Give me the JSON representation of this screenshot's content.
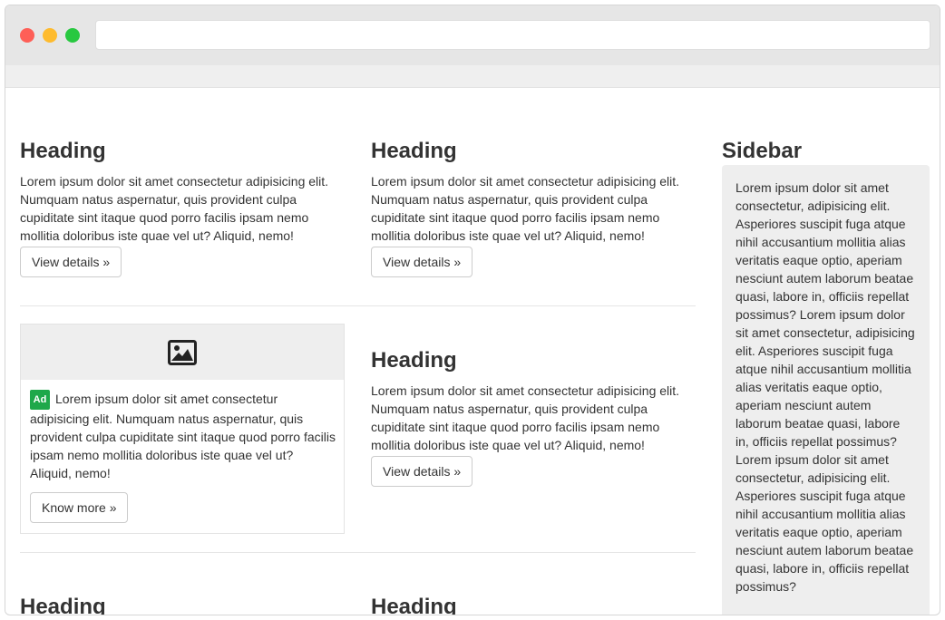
{
  "browser": {
    "url": ""
  },
  "main": {
    "heading_1": "Heading",
    "text_1": "Lorem ipsum dolor sit amet consectetur adipisicing elit. Numquam natus aspernatur, quis provident culpa cupiditate sint itaque quod porro facilis ipsam nemo mollitia doloribus iste quae vel ut? Aliquid, nemo!",
    "button_1": "View details »",
    "heading_2": "Heading",
    "text_2": "Lorem ipsum dolor sit amet consectetur adipisicing elit. Numquam natus aspernatur, quis provident culpa cupiditate sint itaque quod porro facilis ipsam nemo mollitia doloribus iste quae vel ut? Aliquid, nemo!",
    "button_2": "View details »",
    "heading_3": "Heading",
    "text_3": "Lorem ipsum dolor sit amet consectetur adipisicing elit. Numquam natus aspernatur, quis provident culpa cupiditate sint itaque quod porro facilis ipsam nemo mollitia doloribus iste quae vel ut? Aliquid, nemo!",
    "button_3": "View details »",
    "heading_4": "Heading",
    "heading_5": "Heading"
  },
  "ad": {
    "badge": "Ad",
    "text": "Lorem ipsum dolor sit amet consectetur adipisicing elit. Numquam natus aspernatur, quis provident culpa cupiditate sint itaque quod porro facilis ipsam nemo mollitia doloribus iste quae vel ut? Aliquid, nemo!",
    "button": "Know more »",
    "image_icon": "image-icon"
  },
  "sidebar": {
    "title": "Sidebar",
    "text": "Lorem ipsum dolor sit amet consectetur, adipisicing elit. Asperiores suscipit fuga atque nihil accusantium mollitia alias veritatis eaque optio, aperiam nesciunt autem laborum beatae quasi, labore in, officiis repellat possimus? Lorem ipsum dolor sit amet consectetur, adipisicing elit. Asperiores suscipit fuga atque nihil accusantium mollitia alias veritatis eaque optio, aperiam nesciunt autem laborum beatae quasi, labore in, officiis repellat possimus? Lorem ipsum dolor sit amet consectetur, adipisicing elit. Asperiores suscipit fuga atque nihil accusantium mollitia alias veritatis eaque optio, aperiam nesciunt autem laborum beatae quasi, labore in, officiis repellat possimus?"
  },
  "colors": {
    "ad_badge": "#1ea84a",
    "close_dot": "#fe5f57",
    "minimize_dot": "#febb2e",
    "maximize_dot": "#28c840"
  }
}
